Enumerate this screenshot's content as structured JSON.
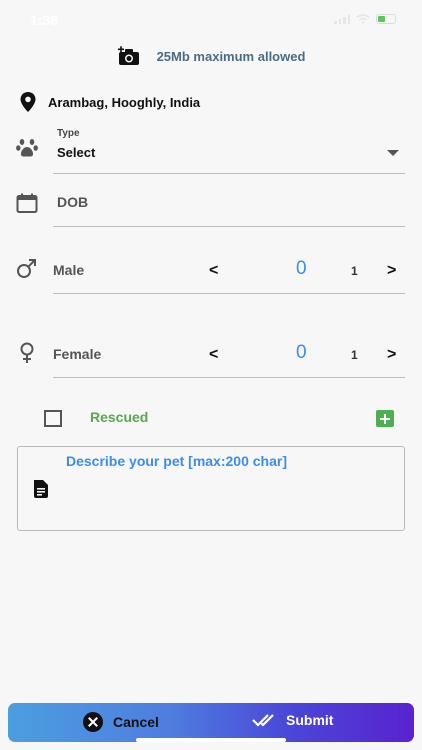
{
  "status_bar": {
    "time": "1:38"
  },
  "photo": {
    "limit_text": "25Mb maximum allowed",
    "icon": "add-camera-icon"
  },
  "location": {
    "text": "Arambag, Hooghly, India",
    "icon": "location-pin-icon"
  },
  "type_field": {
    "label": "Type",
    "value": "Select",
    "icon": "paw-icon"
  },
  "dob_field": {
    "placeholder": "DOB",
    "icon": "calendar-icon"
  },
  "male": {
    "label": "Male",
    "prev": "<",
    "count": "0",
    "step": "1",
    "next": ">",
    "icon": "male-icon"
  },
  "female": {
    "label": "Female",
    "prev": "<",
    "count": "0",
    "step": "1",
    "next": ">",
    "icon": "female-icon"
  },
  "rescued": {
    "label": "Rescued",
    "checked": false
  },
  "description": {
    "placeholder": "Describe your pet [max:200 char]"
  },
  "actions": {
    "cancel_label": "Cancel",
    "submit_label": "Submit"
  },
  "colors": {
    "accent_blue": "#3a8ee6",
    "rescued_green": "#5aa74f",
    "gradient_start": "#4b9ee0",
    "gradient_end": "#5a22d0"
  }
}
